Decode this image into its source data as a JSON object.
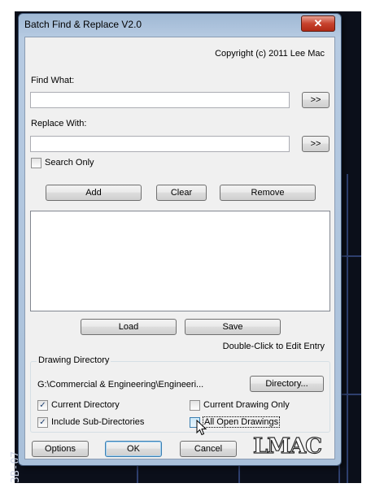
{
  "window": {
    "title": "Batch Find & Replace V2.0",
    "close_symbol": "✕"
  },
  "copyright": "Copyright (c) 2011 Lee Mac",
  "find": {
    "label": "Find What:",
    "value": "",
    "browse_label": ">>"
  },
  "replace": {
    "label": "Replace With:",
    "value": "",
    "browse_label": ">>"
  },
  "search_only": {
    "label": "Search Only",
    "checked": false
  },
  "list_buttons": {
    "add": "Add",
    "clear": "Clear",
    "remove": "Remove"
  },
  "entries": [],
  "file_buttons": {
    "load": "Load",
    "save": "Save"
  },
  "hint": "Double-Click to Edit Entry",
  "drawing_directory": {
    "title": "Drawing Directory",
    "path": "G:\\Commercial & Engineering\\Engineeri...",
    "directory_button": "Directory...",
    "current_directory": {
      "label": "Current Directory",
      "checked": true
    },
    "include_subdirs": {
      "label": "Include Sub-Directories",
      "checked": true
    },
    "current_drawing_only": {
      "label": "Current Drawing Only",
      "checked": false
    },
    "all_open_drawings": {
      "label": "All Open Drawings",
      "checked": false
    }
  },
  "footer": {
    "options": "Options",
    "ok": "OK",
    "cancel": "Cancel"
  },
  "logo_text": "LMAC",
  "cad_labels": {
    "left": "3B-07"
  },
  "icons": {
    "check": "✓",
    "cursor": "arrow-cursor-icon"
  }
}
